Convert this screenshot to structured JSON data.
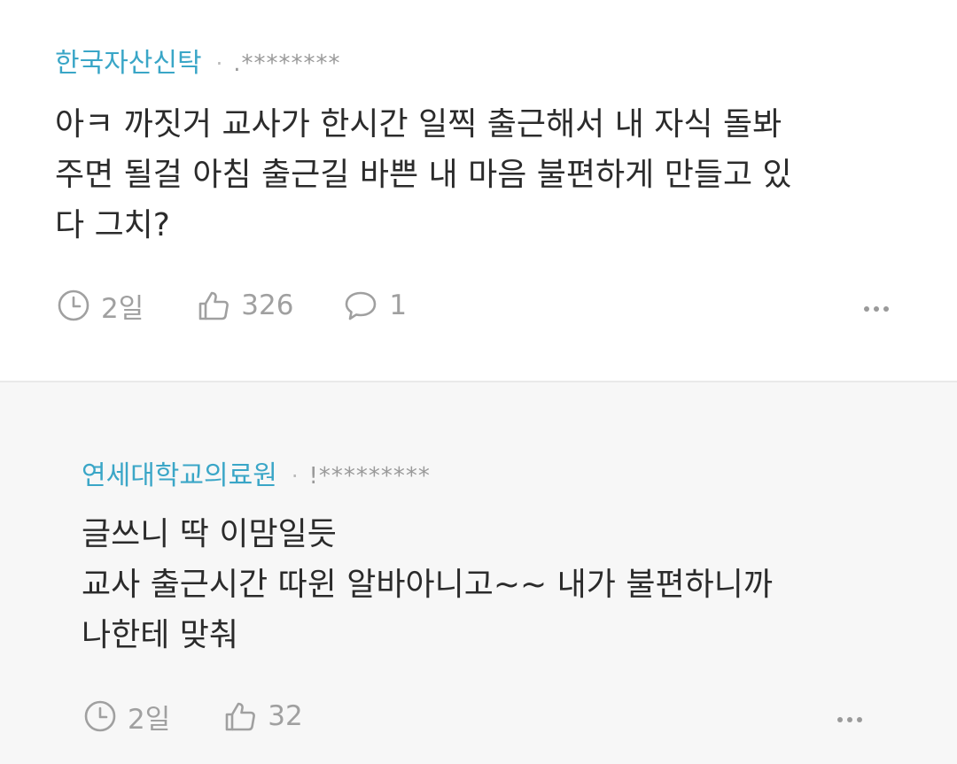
{
  "comments": [
    {
      "author": "한국자산신탁",
      "separator": "·",
      "masked_id": ".********",
      "lines": [
        "아ㅋ 까짓거 교사가 한시간 일찍 출근해서 내 자식 돌봐",
        "주면 될걸 아침 출근길 바쁜 내 마음 불편하게 만들고 있",
        "다 그치?"
      ],
      "time": "2일",
      "likes": "326",
      "replies": "1"
    },
    {
      "author": "연세대학교의료원",
      "separator": "·",
      "masked_id": "!*********",
      "lines": [
        "글쓰니 딱 이맘일듯",
        "교사 출근시간 따윈 알바아니고~~ 내가 불편하니까",
        "나한테 맞춰"
      ],
      "time": "2일",
      "likes": "32"
    }
  ],
  "icons": {
    "time": "clock-icon",
    "like": "thumbs-up-icon",
    "reply": "speech-bubble-icon",
    "more": "more-dots-icon"
  },
  "colors": {
    "author": "#3aa6c7",
    "text": "#2b2b2b",
    "muted": "#a0a0a0",
    "reply_bg": "#f7f7f7"
  }
}
